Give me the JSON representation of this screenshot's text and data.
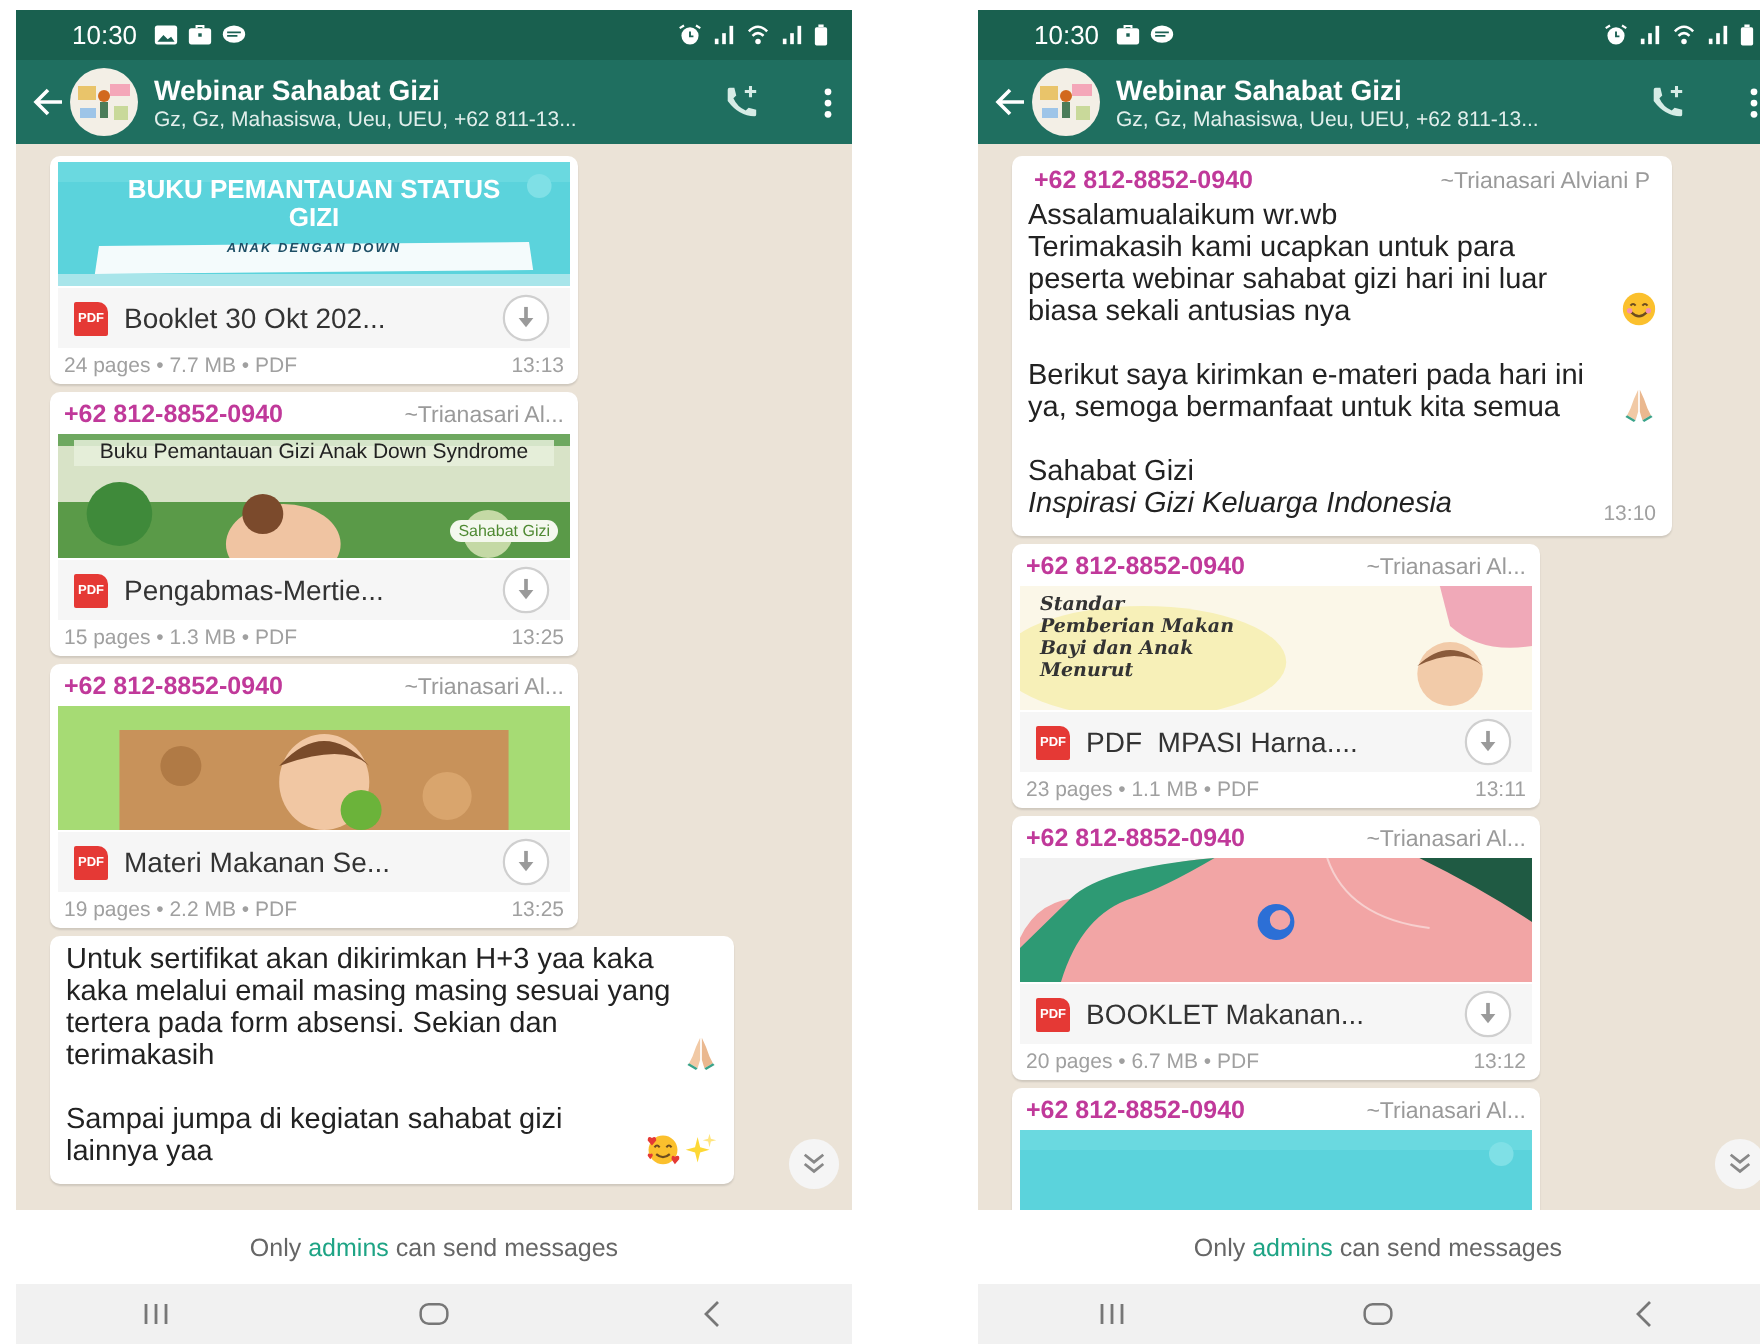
{
  "phones": [
    {
      "status": {
        "time": "10:30",
        "notifications": [
          {
            "kind": "gallery"
          },
          {
            "kind": "briefcase"
          },
          {
            "kind": "chat"
          }
        ]
      },
      "header": {
        "title": "Webinar Sahabat Gizi",
        "subtitle": "Gz, Gz, Mahasiswa, Ueu, UEU, +62 811-13..."
      },
      "messages": [
        {
          "kind": "document",
          "thumb": {
            "kind": "teal-cover",
            "title": "BUKU PEMANTAUAN STATUS GIZI",
            "subtitle": "ANAK DENGAN DOWN"
          },
          "badge": "PDF",
          "file": "Booklet 30 Okt 202...",
          "meta": "24 pages • 7.7 MB • PDF",
          "time": "13:13"
        },
        {
          "kind": "document",
          "sender": "+62 812-8852-0940",
          "name": "~Trianasari Al...",
          "thumb": {
            "kind": "photo-cover",
            "title": "Buku Pemantauan Gizi Anak Down Syndrome",
            "logo": "Sahabat Gizi"
          },
          "badge": "PDF",
          "file": "Pengabmas-Mertie...",
          "meta": "15 pages • 1.3 MB • PDF",
          "time": "13:25"
        },
        {
          "kind": "document",
          "sender": "+62 812-8852-0940",
          "name": "~Trianasari Al...",
          "thumb": {
            "kind": "photo-green"
          },
          "badge": "PDF",
          "file": "Materi Makanan Se...",
          "meta": "19 pages • 2.2 MB • PDF",
          "time": "13:25"
        },
        {
          "kind": "text",
          "paragraphs": [
            {
              "lines": [
                "Untuk sertifikat akan dikirimkan H+3 yaa kaka kaka melalui email masing masing sesuai yang tertera pada form absensi. Sekian dan terimakasih"
              ],
              "emoji": [
                {
                  "kind": "pray"
                }
              ]
            },
            {
              "lines": [
                "Sampai jumpa di kegiatan sahabat gizi lainnya yaa"
              ],
              "emoji": [
                {
                  "kind": "hearts-face"
                },
                {
                  "kind": "sparkles"
                }
              ]
            }
          ]
        }
      ],
      "notice": {
        "before": "Only",
        "link": "admins",
        "after": "can send messages"
      }
    },
    {
      "status": {
        "time": "10:30",
        "notifications": [
          {
            "kind": "briefcase"
          },
          {
            "kind": "chat"
          }
        ]
      },
      "header": {
        "title": "Webinar Sahabat Gizi",
        "subtitle": "Gz, Gz, Mahasiswa, Ueu, UEU, +62 811-13..."
      },
      "messages": [
        {
          "kind": "text",
          "sender": "+62 812-8852-0940",
          "name": "~Trianasari Alviani P",
          "paragraphs": [
            {
              "lines": [
                "Assalamualaikum wr.wb",
                "Terimakasih kami ucapkan untuk para peserta webinar sahabat gizi hari ini luar biasa sekali antusias nya"
              ],
              "emoji": [
                {
                  "kind": "smile"
                }
              ]
            },
            {
              "lines": [
                "Berikut saya kirimkan e-materi pada hari ini ya, semoga bermanfaat untuk kita semua"
              ],
              "emoji": [
                {
                  "kind": "pray"
                }
              ]
            },
            {
              "lines": [
                "Sahabat Gizi",
                " *Inspirasi Gizi Keluarga Indonesia*"
              ]
            }
          ],
          "time": "13:10"
        },
        {
          "kind": "document",
          "sender": "+62 812-8852-0940",
          "name": "~Trianasari Al...",
          "thumb": {
            "kind": "yellow-cover",
            "title": "Standar Pemberian Makan Bayi dan Anak Menurut"
          },
          "badge": "PDF",
          "file": "PDF  MPASI Harna....",
          "meta": "23 pages • 1.1 MB • PDF",
          "time": "13:11"
        },
        {
          "kind": "document",
          "sender": "+62 812-8852-0940",
          "name": "~Trianasari Al...",
          "thumb": {
            "kind": "pink-cover"
          },
          "badge": "PDF",
          "file": "BOOKLET Makanan...",
          "meta": "20 pages • 6.7 MB • PDF",
          "time": "13:12"
        },
        {
          "kind": "document",
          "sender": "+62 812-8852-0940",
          "name": "~Trianasari Al...",
          "thumb": {
            "kind": "teal-cover"
          }
        }
      ],
      "notice": {
        "before": "Only",
        "link": "admins",
        "after": "can send messages"
      }
    }
  ]
}
